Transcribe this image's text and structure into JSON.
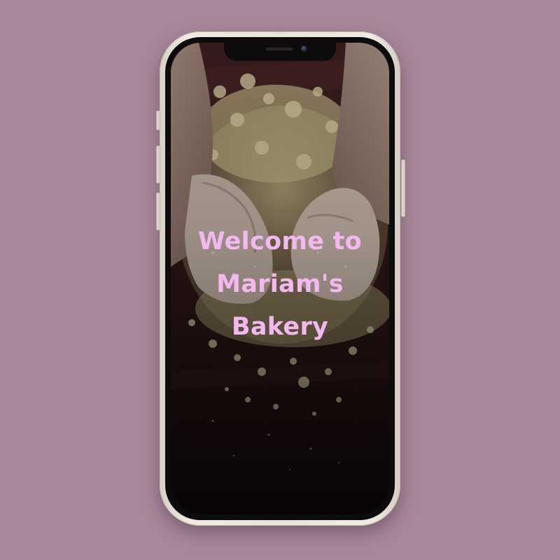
{
  "screen": {
    "welcome_title": "Welcome to Mariam's Bakery",
    "background_image": "hands-kneading-dough-photo"
  },
  "colors": {
    "page_background": "#a78799",
    "frame": "#e9e4db",
    "title_text": "#f4b8f0"
  }
}
